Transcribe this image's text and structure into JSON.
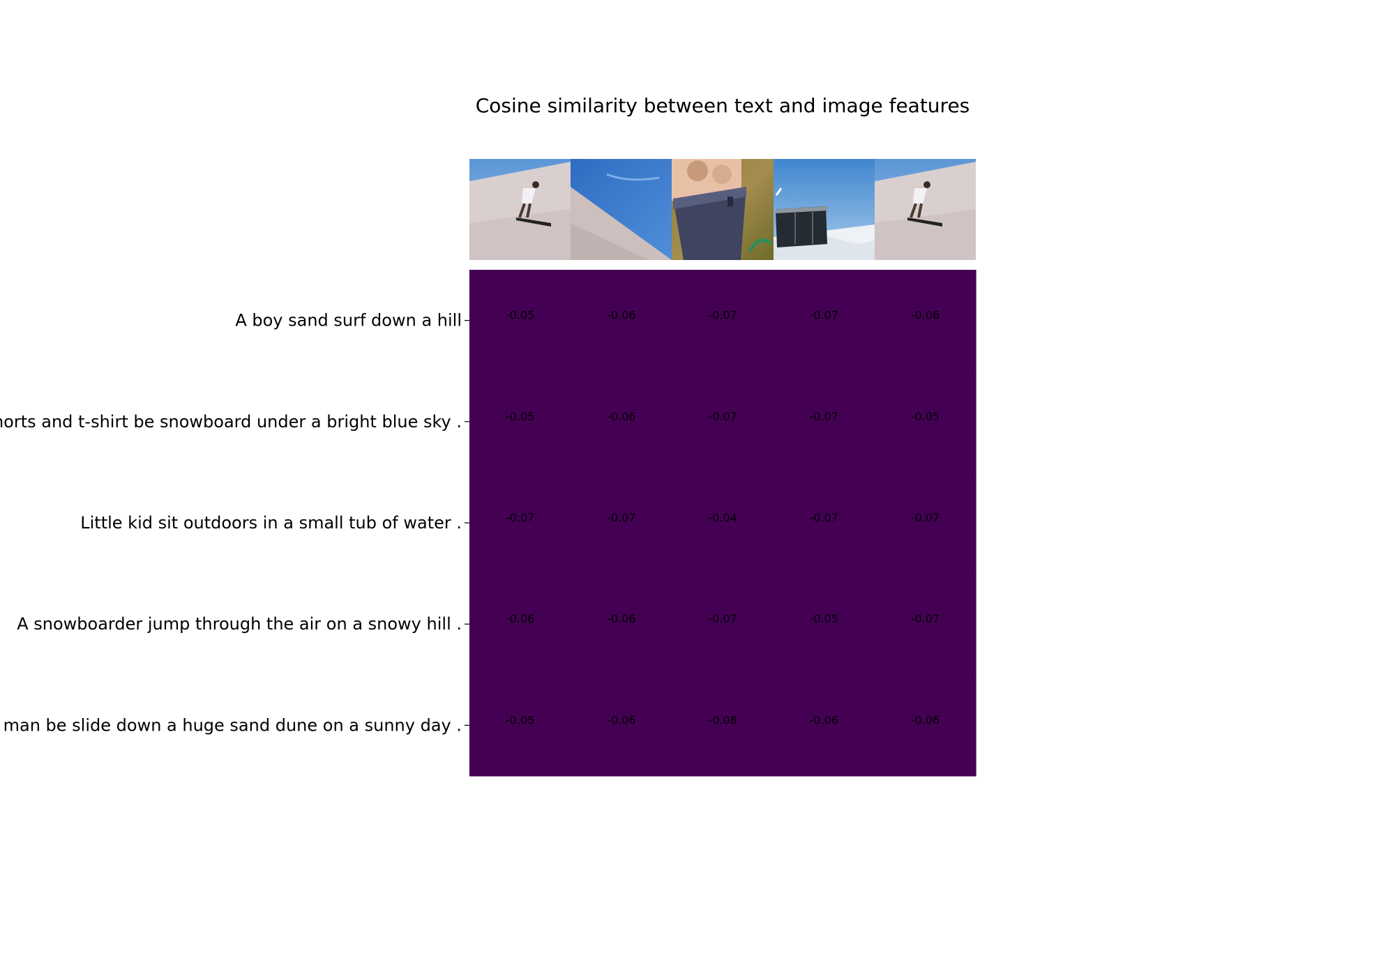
{
  "chart_data": {
    "type": "heatmap",
    "title": "Cosine similarity between text and image features",
    "row_labels": [
      "A boy sand surf down a hill",
      "A man in shorts and t-shirt be snowboard under a bright blue sky .",
      "Little kid sit outdoors in a small tub of water .",
      "A snowboarder jump through the air on a snowy hill .",
      "A man be slide down a huge sand dune on a sunny day ."
    ],
    "column_images": [
      "boy-sand-surfing-thumbnail",
      "sand-dune-and-blue-sky-thumbnail",
      "child-in-tub-thumbnail",
      "snowboarder-over-snow-thumbnail",
      "boy-sand-surfing-thumbnail"
    ],
    "values": [
      [
        "-0.05",
        "-0.06",
        "-0.07",
        "-0.07",
        "-0.06"
      ],
      [
        "-0.05",
        "-0.06",
        "-0.07",
        "-0.07",
        "-0.05"
      ],
      [
        "-0.07",
        "-0.07",
        "-0.04",
        "-0.07",
        "-0.07"
      ],
      [
        "-0.06",
        "-0.06",
        "-0.07",
        "-0.05",
        "-0.07"
      ],
      [
        "-0.05",
        "-0.06",
        "-0.08",
        "-0.06",
        "-0.06"
      ]
    ],
    "colormap": "viridis",
    "cell_color": "#440154"
  }
}
